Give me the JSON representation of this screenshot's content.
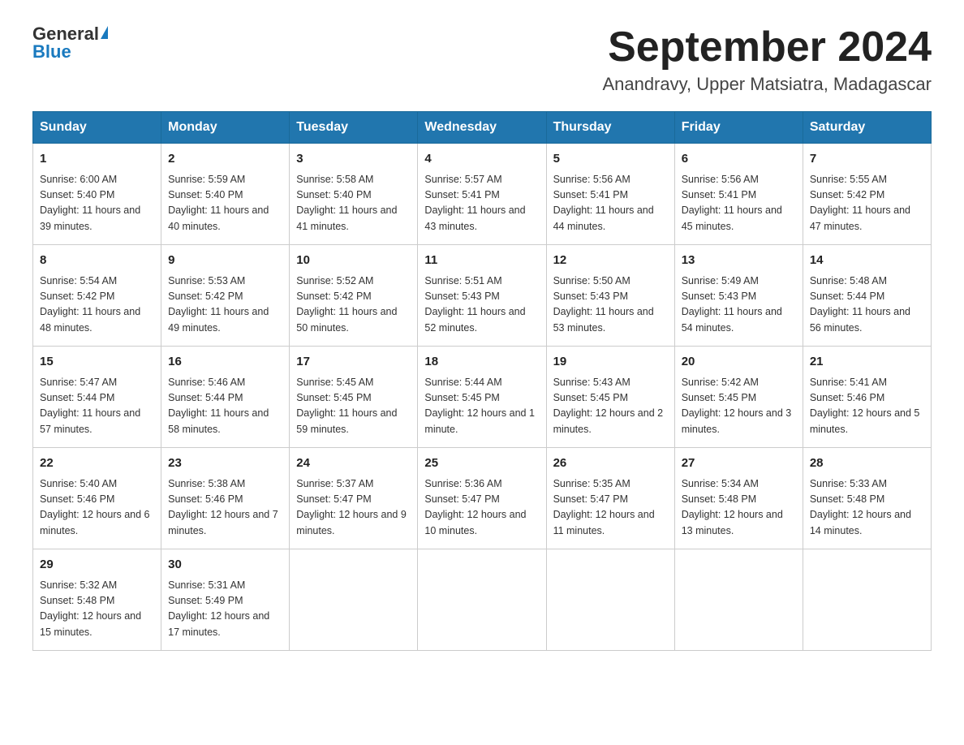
{
  "logo": {
    "text_general": "General",
    "text_blue": "Blue"
  },
  "header": {
    "month_year": "September 2024",
    "location": "Anandravy, Upper Matsiatra, Madagascar"
  },
  "days_of_week": [
    "Sunday",
    "Monday",
    "Tuesday",
    "Wednesday",
    "Thursday",
    "Friday",
    "Saturday"
  ],
  "weeks": [
    [
      {
        "day": "1",
        "sunrise": "6:00 AM",
        "sunset": "5:40 PM",
        "daylight": "11 hours and 39 minutes."
      },
      {
        "day": "2",
        "sunrise": "5:59 AM",
        "sunset": "5:40 PM",
        "daylight": "11 hours and 40 minutes."
      },
      {
        "day": "3",
        "sunrise": "5:58 AM",
        "sunset": "5:40 PM",
        "daylight": "11 hours and 41 minutes."
      },
      {
        "day": "4",
        "sunrise": "5:57 AM",
        "sunset": "5:41 PM",
        "daylight": "11 hours and 43 minutes."
      },
      {
        "day": "5",
        "sunrise": "5:56 AM",
        "sunset": "5:41 PM",
        "daylight": "11 hours and 44 minutes."
      },
      {
        "day": "6",
        "sunrise": "5:56 AM",
        "sunset": "5:41 PM",
        "daylight": "11 hours and 45 minutes."
      },
      {
        "day": "7",
        "sunrise": "5:55 AM",
        "sunset": "5:42 PM",
        "daylight": "11 hours and 47 minutes."
      }
    ],
    [
      {
        "day": "8",
        "sunrise": "5:54 AM",
        "sunset": "5:42 PM",
        "daylight": "11 hours and 48 minutes."
      },
      {
        "day": "9",
        "sunrise": "5:53 AM",
        "sunset": "5:42 PM",
        "daylight": "11 hours and 49 minutes."
      },
      {
        "day": "10",
        "sunrise": "5:52 AM",
        "sunset": "5:42 PM",
        "daylight": "11 hours and 50 minutes."
      },
      {
        "day": "11",
        "sunrise": "5:51 AM",
        "sunset": "5:43 PM",
        "daylight": "11 hours and 52 minutes."
      },
      {
        "day": "12",
        "sunrise": "5:50 AM",
        "sunset": "5:43 PM",
        "daylight": "11 hours and 53 minutes."
      },
      {
        "day": "13",
        "sunrise": "5:49 AM",
        "sunset": "5:43 PM",
        "daylight": "11 hours and 54 minutes."
      },
      {
        "day": "14",
        "sunrise": "5:48 AM",
        "sunset": "5:44 PM",
        "daylight": "11 hours and 56 minutes."
      }
    ],
    [
      {
        "day": "15",
        "sunrise": "5:47 AM",
        "sunset": "5:44 PM",
        "daylight": "11 hours and 57 minutes."
      },
      {
        "day": "16",
        "sunrise": "5:46 AM",
        "sunset": "5:44 PM",
        "daylight": "11 hours and 58 minutes."
      },
      {
        "day": "17",
        "sunrise": "5:45 AM",
        "sunset": "5:45 PM",
        "daylight": "11 hours and 59 minutes."
      },
      {
        "day": "18",
        "sunrise": "5:44 AM",
        "sunset": "5:45 PM",
        "daylight": "12 hours and 1 minute."
      },
      {
        "day": "19",
        "sunrise": "5:43 AM",
        "sunset": "5:45 PM",
        "daylight": "12 hours and 2 minutes."
      },
      {
        "day": "20",
        "sunrise": "5:42 AM",
        "sunset": "5:45 PM",
        "daylight": "12 hours and 3 minutes."
      },
      {
        "day": "21",
        "sunrise": "5:41 AM",
        "sunset": "5:46 PM",
        "daylight": "12 hours and 5 minutes."
      }
    ],
    [
      {
        "day": "22",
        "sunrise": "5:40 AM",
        "sunset": "5:46 PM",
        "daylight": "12 hours and 6 minutes."
      },
      {
        "day": "23",
        "sunrise": "5:38 AM",
        "sunset": "5:46 PM",
        "daylight": "12 hours and 7 minutes."
      },
      {
        "day": "24",
        "sunrise": "5:37 AM",
        "sunset": "5:47 PM",
        "daylight": "12 hours and 9 minutes."
      },
      {
        "day": "25",
        "sunrise": "5:36 AM",
        "sunset": "5:47 PM",
        "daylight": "12 hours and 10 minutes."
      },
      {
        "day": "26",
        "sunrise": "5:35 AM",
        "sunset": "5:47 PM",
        "daylight": "12 hours and 11 minutes."
      },
      {
        "day": "27",
        "sunrise": "5:34 AM",
        "sunset": "5:48 PM",
        "daylight": "12 hours and 13 minutes."
      },
      {
        "day": "28",
        "sunrise": "5:33 AM",
        "sunset": "5:48 PM",
        "daylight": "12 hours and 14 minutes."
      }
    ],
    [
      {
        "day": "29",
        "sunrise": "5:32 AM",
        "sunset": "5:48 PM",
        "daylight": "12 hours and 15 minutes."
      },
      {
        "day": "30",
        "sunrise": "5:31 AM",
        "sunset": "5:49 PM",
        "daylight": "12 hours and 17 minutes."
      },
      null,
      null,
      null,
      null,
      null
    ]
  ]
}
